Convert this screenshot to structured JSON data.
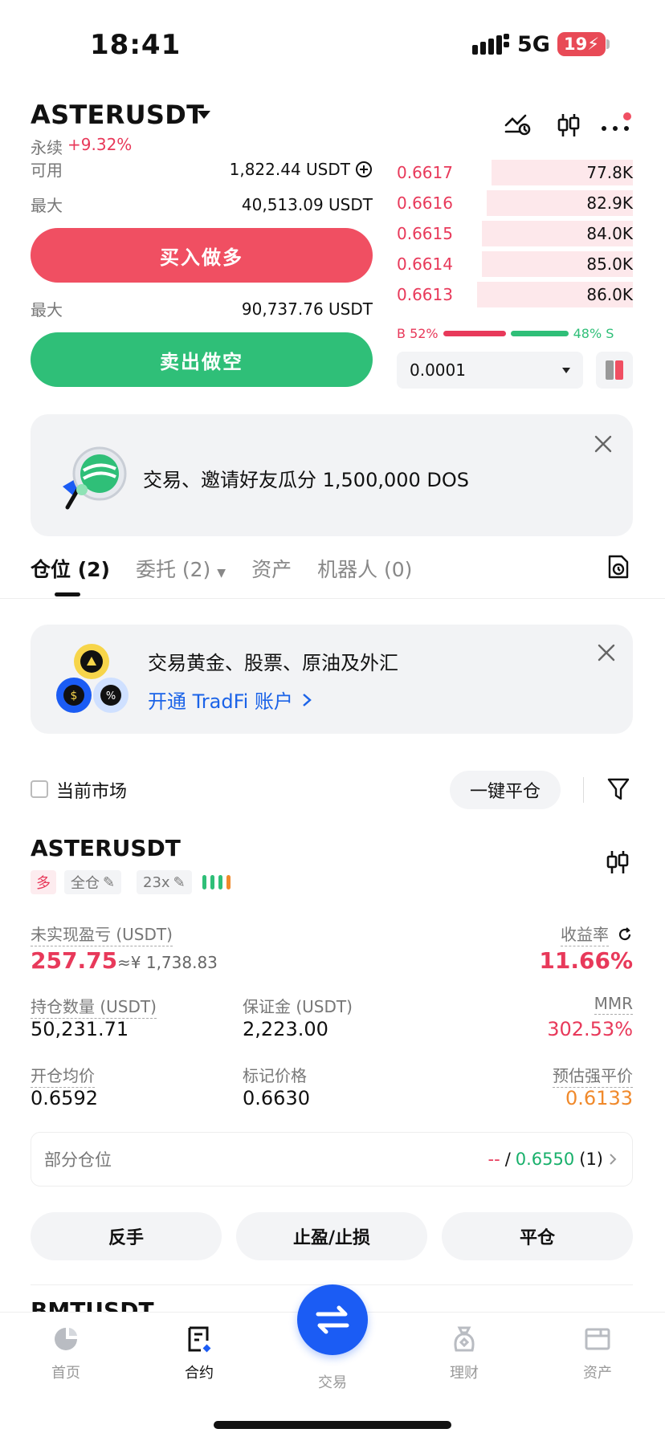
{
  "status_bar": {
    "time": "18:41",
    "network": "5G",
    "battery": "19"
  },
  "header": {
    "symbol": "ASTERUSDT",
    "contract_type": "永续",
    "change": "+9.32%"
  },
  "trade_panel": {
    "available_label": "可用",
    "available_value": "1,822.44 USDT",
    "max_buy_label": "最大",
    "max_buy_value": "40,513.09 USDT",
    "buy_button": "买入做多",
    "max_sell_label": "最大",
    "max_sell_value": "90,737.76 USDT",
    "sell_button": "卖出做空"
  },
  "orderbook": {
    "asks": [
      {
        "price": "0.6617",
        "qty": "77.8K",
        "depth": 0.6
      },
      {
        "price": "0.6616",
        "qty": "82.9K",
        "depth": 0.62
      },
      {
        "price": "0.6615",
        "qty": "84.0K",
        "depth": 0.64
      },
      {
        "price": "0.6614",
        "qty": "85.0K",
        "depth": 0.64
      },
      {
        "price": "0.6613",
        "qty": "86.0K",
        "depth": 0.66
      }
    ],
    "buy_ratio_label": "B 52%",
    "sell_ratio_label": "48% S",
    "buy_ratio": 0.52,
    "precision": "0.0001"
  },
  "promo1": {
    "text": "交易、邀请好友瓜分 1,500,000 DOS"
  },
  "tabs": [
    {
      "label": "仓位 (2)",
      "active": true
    },
    {
      "label": "委托 (2)",
      "active": false
    },
    {
      "label": "资产",
      "active": false
    },
    {
      "label": "机器人 (0)",
      "active": false
    }
  ],
  "promo2": {
    "title": "交易黄金、股票、原油及外汇",
    "link": "开通 TradFi 账户"
  },
  "filter": {
    "current_market": "当前市场",
    "close_all": "一键平仓"
  },
  "position": {
    "symbol": "ASTERUSDT",
    "side": "多",
    "margin_mode": "全仓",
    "leverage": "23x",
    "upnl_label": "未实现盈亏 (USDT)",
    "upnl": "257.75",
    "upnl_cny": "≈¥ 1,738.83",
    "roe_label": "收益率",
    "roe": "11.66%",
    "size_label": "持仓数量 (USDT)",
    "size": "50,231.71",
    "margin_label": "保证金 (USDT)",
    "margin": "2,223.00",
    "mmr_label": "MMR",
    "mmr": "302.53%",
    "entry_label": "开仓均价",
    "entry": "0.6592",
    "mark_label": "标记价格",
    "mark": "0.6630",
    "liq_label": "预估强平价",
    "liq": "0.6133",
    "partial_label": "部分仓位",
    "partial_dash": "--",
    "partial_sep": "/",
    "partial_price": "0.6550",
    "partial_count": "(1)",
    "reverse": "反手",
    "tpsl": "止盈/止损",
    "close": "平仓"
  },
  "next_position": {
    "symbol": "BMTUSDT"
  },
  "bottom_nav": [
    {
      "label": "首页",
      "icon": "home-icon"
    },
    {
      "label": "合约",
      "icon": "contract-icon"
    },
    {
      "label": "交易",
      "icon": "swap-icon"
    },
    {
      "label": "理财",
      "icon": "finance-icon"
    },
    {
      "label": "资产",
      "icon": "wallet-icon"
    }
  ],
  "colors": {
    "buy": "#f04f62",
    "sell": "#2fbf78",
    "accent": "#1b5cf4"
  }
}
